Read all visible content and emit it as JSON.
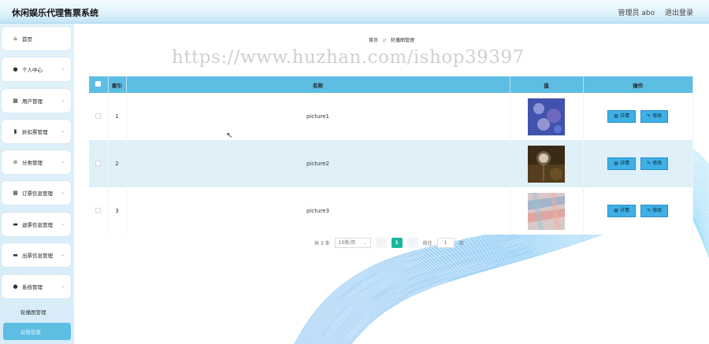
{
  "header": {
    "app_title": "休闲娱乐代理售票系统",
    "user_label": "管理员 abo",
    "logout_label": "退出登录"
  },
  "sidebar": {
    "items": [
      {
        "label": "首页",
        "icon": "home-icon"
      },
      {
        "label": "个人中心",
        "icon": "person-icon"
      },
      {
        "label": "用户管理",
        "icon": "grid-icon"
      },
      {
        "label": "折扣票管理",
        "icon": "book-icon"
      },
      {
        "label": "分类管理",
        "icon": "list-icon"
      },
      {
        "label": "订票信息管理",
        "icon": "grid-icon"
      },
      {
        "label": "退票信息管理",
        "icon": "monitor-icon"
      },
      {
        "label": "出票信息管理",
        "icon": "monitor-icon"
      },
      {
        "label": "系统管理",
        "icon": "person-icon"
      }
    ],
    "sub_items": [
      {
        "label": "轮播图管理",
        "active": false
      },
      {
        "label": "公告信息",
        "active": true
      }
    ]
  },
  "breadcrumb": {
    "home": "首页",
    "separator": "//",
    "current": "轮播图管理"
  },
  "watermark": "https://www.huzhan.com/ishop39397",
  "table": {
    "columns": {
      "index": "索引",
      "name": "名称",
      "value": "值",
      "actions": "操作"
    },
    "rows": [
      {
        "index": "1",
        "name": "picture1",
        "image": "blue-flower-image"
      },
      {
        "index": "2",
        "name": "picture2",
        "image": "dark-dandelion-image"
      },
      {
        "index": "3",
        "name": "picture3",
        "image": "pastel-painting-image"
      }
    ],
    "detail_label": "详情",
    "edit_label": "修改"
  },
  "pagination": {
    "total": "共 3 条",
    "page_size": "10条/页",
    "prev": "‹",
    "current": "1",
    "next": "›",
    "goto_label": "前往",
    "goto_value": "1",
    "page_unit": "页"
  },
  "colors": {
    "accent": "#5ebde3",
    "button": "#3db0e6",
    "page_active": "#18b69e"
  }
}
